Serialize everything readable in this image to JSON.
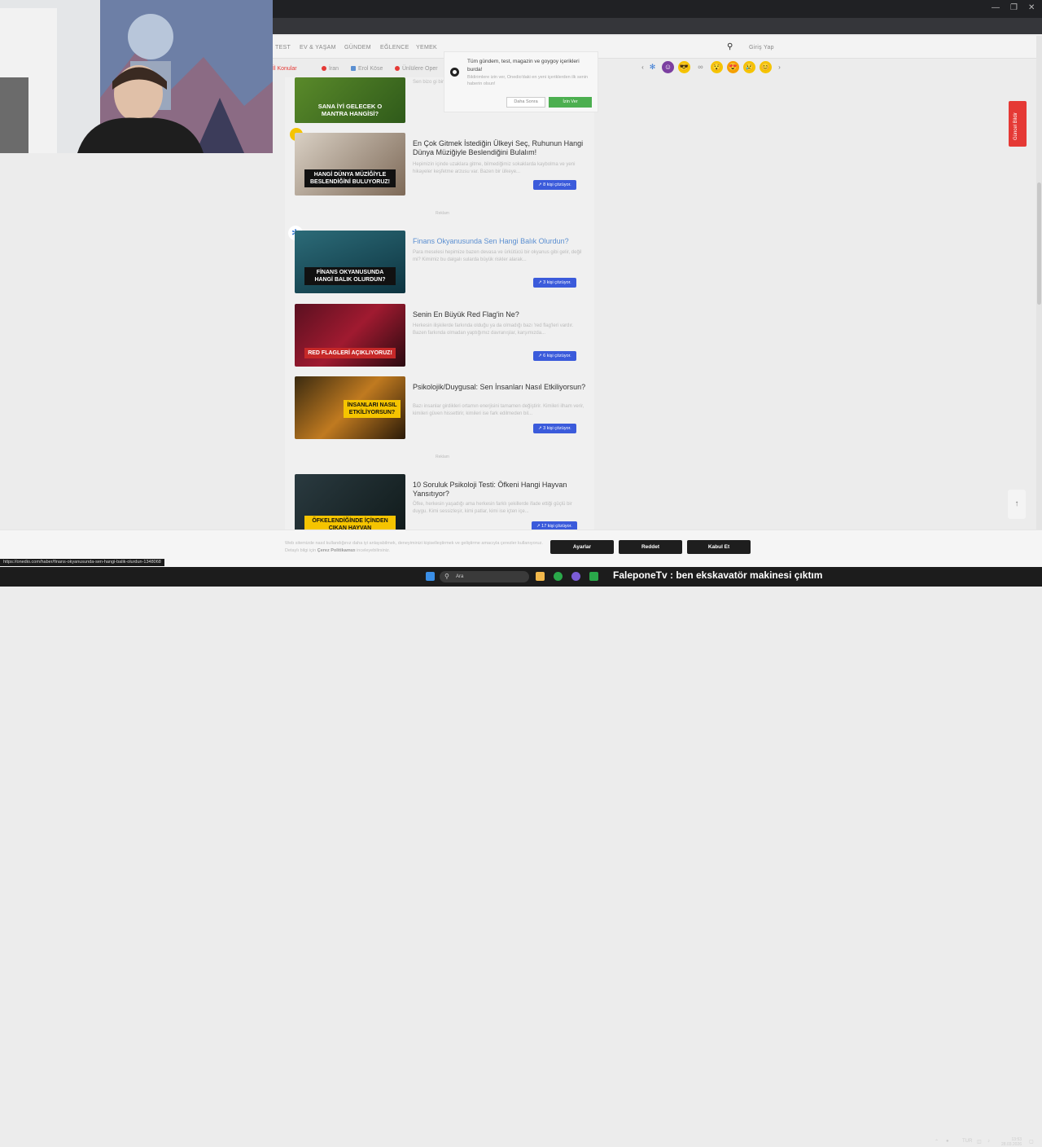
{
  "site_nav": {
    "items": [
      "TEST",
      "EV & YAŞAM",
      "GÜNDEM",
      "EĞLENCE",
      "YEMEK"
    ],
    "login": "Giriş Yap"
  },
  "chips": [
    {
      "label": "İl Konular",
      "color": "#e53935"
    },
    {
      "label": "İran",
      "color": "#e53935"
    },
    {
      "label": "Erol Köse",
      "color": "#5b8fd1"
    },
    {
      "label": "Ünlülere Oper",
      "color": "#e53935"
    }
  ],
  "emojis": [
    "✻",
    "☺",
    "😎",
    "∞",
    "😯",
    "😍",
    "😢",
    "😊"
  ],
  "popup": {
    "title": "Tüm gündem, test, magazin ve goygoy içerikleri burda!",
    "desc": "Bildirimlere izin ver, Onedio'daki en yeni içeriklerden ilk senin haberin olsun!",
    "later": "Daha Sonra",
    "allow": "İzin Ver"
  },
  "cards": [
    {
      "title": "",
      "thumb_text": "SANA İYİ GELECEK O MANTRA HANGİSİ?",
      "desc": "Sen bizo gi bir de hem",
      "badge": ""
    },
    {
      "title": "En Çok Gitmek İstediğin Ülkeyi Seç, Ruhunun Hangi Dünya Müziğiyle Beslendiğini Bulalım!",
      "thumb_text": "HANGİ DÜNYA MÜZİĞİYLE BESLENDİĞİNİ BULUYORUZ!",
      "desc": "Hepimizin içinde uzaklara gitme, bilmediğimiz sokaklarda kaybolma ve yeni hikayeler keşfetme arzusu var. Bazen bir ülkeye...",
      "badge": "8 kişi çözüyor."
    },
    {
      "title": "Finans Okyanusunda Sen Hangi Balık Olurdun?",
      "thumb_text": "FİNANS OKYANUSUNDA HANGİ BALIK OLURDUN?",
      "desc": "Para meselesi hepimize bazen devasa ve ürkütücü bir okyanus gibi gelir, değil mi? Kimimiz bu dalgalı sularda büyük riskler alarak...",
      "badge": "3 kişi çözüyor."
    },
    {
      "title": "Senin En Büyük Red Flag'in Ne?",
      "thumb_text": "RED FLAGLERİ AÇIKLIYORUZ!",
      "desc": "Herkesin ilişkilerde farkında olduğu ya da olmadığı bazı 'red flag'leri vardır. Bazen farkında olmadan yaptığımız davranışlar, karşımızda...",
      "badge": "6 kişi çözüyor."
    },
    {
      "title": "Psikolojik/Duygusal: Sen İnsanları Nasıl Etkiliyorsun?",
      "thumb_text": "İNSANLARI NASIL ETKİLİYORSUN?",
      "desc": "Bazı insanlar girdikleri ortamın enerjisini tamamen değiştirir. Kimileri ilham verir, kimileri güven hissettirir, kimileri ise fark edilmeden bil...",
      "badge": "3 kişi çözüyor."
    },
    {
      "title": "10 Soruluk Psikoloji Testi: Öfkeni Hangi Hayvan Yansıtıyor?",
      "thumb_text": "ÖFKELENDİĞİNDE İÇİNDEN ÇIKAN HAYVAN",
      "desc": "Öfke, herkesin yaşadığı ama herkesin farklı şekillerde ifade ettiği güçlü bir duygu. Kimi sessizleşir, kimi patlar, kimi ise içten içe...",
      "badge": "17 kişi çözüyor."
    }
  ],
  "reklam": "Reklam",
  "side_tab": "Güncel Bildir",
  "cookie": {
    "text": "Web sitemizde nasıl kullandığınız daha iyi anlayabilmek, deneyiminizi kişiselleştirmek ve geliştirme amacıyla çerezler kullanıyoruz. Detaylı bilgi için",
    "link": "Çerez Politikamızı",
    "text_end": "inceleyebilirsiniz.",
    "btn_settings": "Ayarlar",
    "btn_reject": "Reddet",
    "btn_accept": "Kabul Et"
  },
  "status_url": "https://onedio.com/haber/finans-okyanusunda-sen-hangi-balik-olurdun-1348068",
  "taskbar": {
    "search": "Ara",
    "overlay": "FaleponeTv : ben ekskavatör makinesi çıktım",
    "lang": "TUR",
    "time": "13:53",
    "date": "28.03.2026"
  }
}
